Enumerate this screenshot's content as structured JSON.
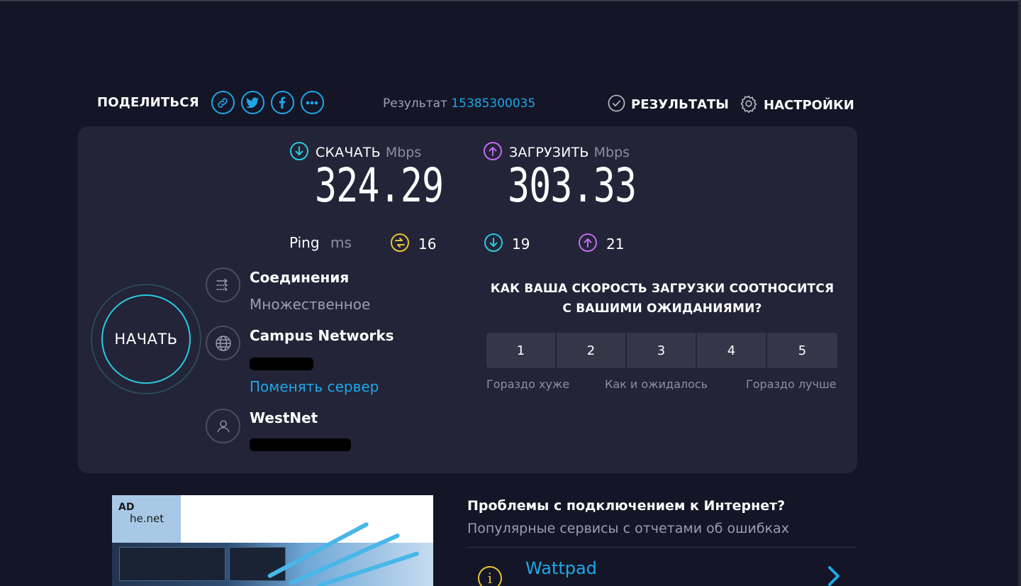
{
  "header": {
    "share_label": "ПОДЕЛИТЬСЯ",
    "share_buttons": [
      "link-icon",
      "twitter-icon",
      "facebook-icon",
      "more-icon"
    ],
    "result_label": "Результат",
    "result_id": "15385300035",
    "results_label": "РЕЗУЛЬТАТЫ",
    "settings_label": "НАСТРОЙКИ"
  },
  "download": {
    "label": "СКАЧАТЬ",
    "unit": "Mbps",
    "value": "324.29",
    "color": "#29c9e1"
  },
  "upload": {
    "label": "ЗАГРУЗИТЬ",
    "unit": "Mbps",
    "value": "303.33",
    "color": "#c06cf0"
  },
  "ping": {
    "label": "Ping",
    "unit": "ms",
    "idle": "16",
    "download": "19",
    "upload": "21",
    "idle_color": "#e7c633"
  },
  "start_label": "НАЧАТЬ",
  "connections": {
    "title": "Соединения",
    "value": "Множественное"
  },
  "server": {
    "name": "Campus Networks",
    "change_link": "Поменять сервер"
  },
  "provider": {
    "name": "WestNet"
  },
  "survey": {
    "question": "КАК ВАША СКОРОСТЬ ЗАГРУЗКИ СООТНОСИТСЯ С ВАШИМИ ОЖИДАНИЯМИ?",
    "options": [
      "1",
      "2",
      "3",
      "4",
      "5"
    ],
    "low_label": "Гораздо хуже",
    "mid_label": "Как и ожидалось",
    "high_label": "Гораздо лучше"
  },
  "ad": {
    "badge": "AD",
    "domain": "he.net"
  },
  "problems": {
    "title": "Проблемы с подключением к Интернет?",
    "subtitle": "Популярные сервисы с отчетами об ошибках",
    "items": [
      {
        "name": "Wattpad"
      }
    ]
  },
  "colors": {
    "accent": "#1ea7e8",
    "background": "#141526",
    "card": "#232437"
  }
}
